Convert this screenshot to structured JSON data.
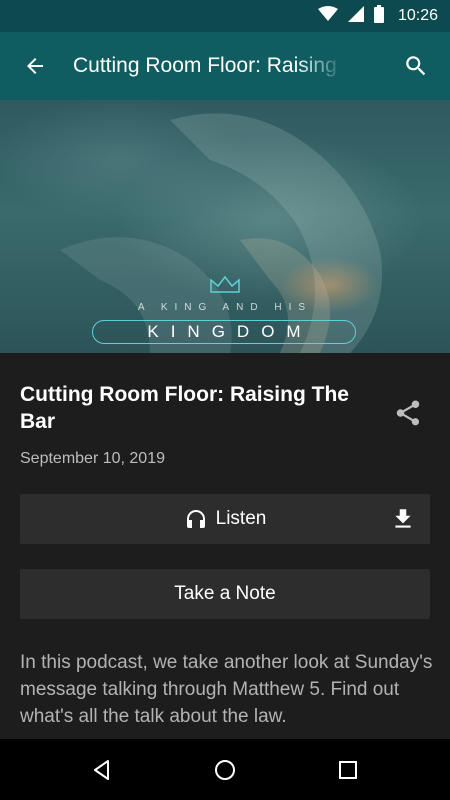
{
  "status_bar": {
    "time": "10:26"
  },
  "app_bar": {
    "title": "Cutting Room Floor: Raising The Bar"
  },
  "hero": {
    "subtitle": "A KING AND HIS",
    "title": "KINGDOM"
  },
  "episode": {
    "title": "Cutting Room Floor: Raising The Bar",
    "date": "September 10, 2019",
    "listen_label": "Listen",
    "note_label": "Take a Note",
    "description": "In this podcast, we take another look at Sunday's message talking through Matthew 5. Find out what's all the talk about the law."
  },
  "colors": {
    "status_bar": "#0c4a4f",
    "app_bar": "#0f5c61",
    "background": "#1d1d1d",
    "button": "#2d2d2d",
    "accent": "#5fd0d6"
  },
  "icons": [
    "wifi-icon",
    "signal-icon",
    "battery-icon",
    "back-arrow-icon",
    "search-icon",
    "crown-icon",
    "share-icon",
    "headphones-icon",
    "download-icon",
    "nav-back-icon",
    "nav-home-icon",
    "nav-recents-icon"
  ]
}
